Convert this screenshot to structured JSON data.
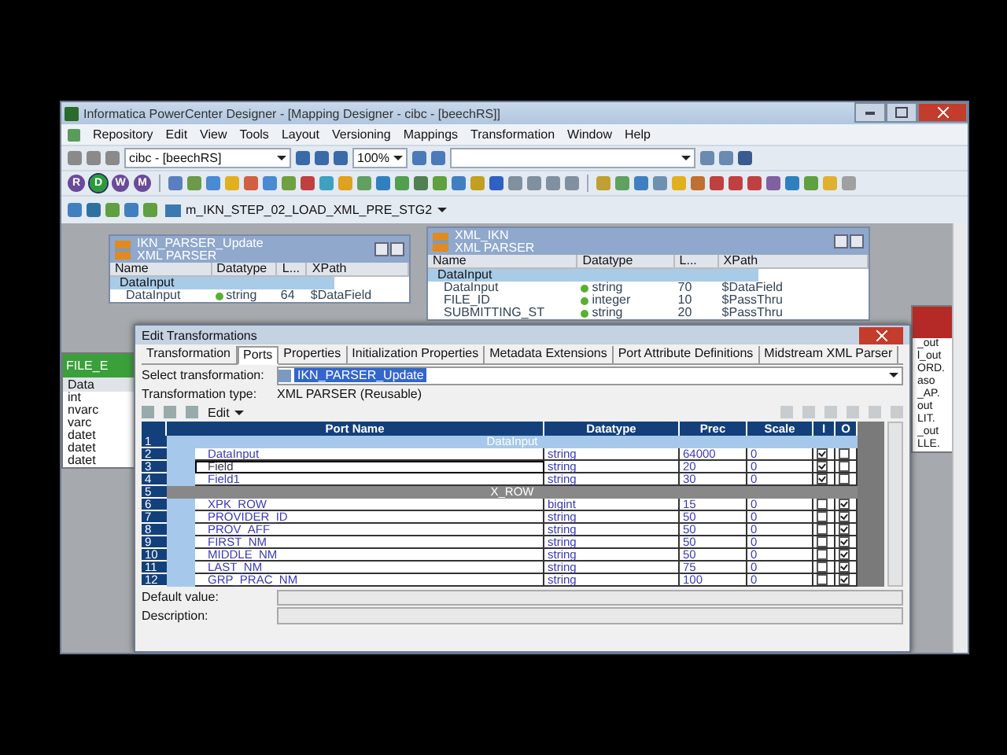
{
  "window": {
    "title": "Informatica PowerCenter Designer - [Mapping Designer - cibc - [beechRS]]"
  },
  "menu": [
    "Repository",
    "Edit",
    "View",
    "Tools",
    "Layout",
    "Versioning",
    "Mappings",
    "Transformation",
    "Window",
    "Help"
  ],
  "toolbar": {
    "repository_combo": "cibc - [beechRS]",
    "zoom_combo": "100%",
    "tool_buttons": [
      {
        "label": "R",
        "selected": false
      },
      {
        "label": "D",
        "selected": true
      },
      {
        "label": "W",
        "selected": false
      },
      {
        "label": "M",
        "selected": false
      }
    ],
    "mapping_combo": "m_IKN_STEP_02_LOAD_XML_PRE_STG2"
  },
  "canvas_objects": [
    {
      "title": "IKN_PARSER_Update",
      "subtitle": "XML PARSER",
      "columns": [
        "Name",
        "Datatype",
        "L...",
        "XPath"
      ],
      "ports": [
        {
          "kind": "group",
          "name": "DataInput"
        },
        {
          "kind": "port",
          "name": "DataInput",
          "datatype": "string",
          "length": "64",
          "xpath": "$DataField"
        }
      ]
    },
    {
      "title": "XML_IKN",
      "subtitle": "XML PARSER",
      "columns": [
        "Name",
        "Datatype",
        "L...",
        "XPath"
      ],
      "ports": [
        {
          "kind": "group",
          "name": "DataInput"
        },
        {
          "kind": "port",
          "name": "DataInput",
          "datatype": "string",
          "length": "70",
          "xpath": "$DataField"
        },
        {
          "kind": "port",
          "name": "FILE_ID",
          "datatype": "integer",
          "length": "10",
          "xpath": "$PassThru"
        },
        {
          "kind": "port",
          "name": "SUBMITTING_ST",
          "datatype": "string",
          "length": "20",
          "xpath": "$PassThru"
        }
      ]
    }
  ],
  "left_object": {
    "title": "FILE_E",
    "column": "Data",
    "rows": [
      "int",
      "nvarc",
      "varc",
      "datet",
      "datet",
      "datet"
    ]
  },
  "right_object": {
    "rows": [
      "_out",
      "l_out",
      "ORD.",
      "aso",
      "_AP.",
      "out",
      "LIT.",
      "_out",
      "LLE."
    ]
  },
  "dialog": {
    "title": "Edit Transformations",
    "tabs": [
      {
        "label": "Transformation",
        "selected": false
      },
      {
        "label": "Ports",
        "selected": true
      },
      {
        "label": "Properties",
        "selected": false
      },
      {
        "label": "Initialization Properties",
        "selected": false
      },
      {
        "label": "Metadata Extensions",
        "selected": false
      },
      {
        "label": "Port Attribute Definitions",
        "selected": false
      },
      {
        "label": "Midstream XML Parser",
        "selected": false
      }
    ],
    "select_label": "Select transformation:",
    "select_value": "IKN_PARSER_Update",
    "type_label": "Transformation type:",
    "type_value": "XML PARSER (Reusable)",
    "edit_menu": "Edit",
    "columns": [
      "Port Name",
      "Datatype",
      "Prec",
      "Scale",
      "I",
      "O"
    ],
    "rows": [
      {
        "kind": "group",
        "num": "1",
        "name": "DataInput",
        "selected": true
      },
      {
        "kind": "port",
        "num": "2",
        "name": "DataInput",
        "datatype": "string",
        "prec": "64000",
        "scale": "0",
        "input": true,
        "output": false,
        "selected": false
      },
      {
        "kind": "port",
        "num": "3",
        "name": "Field",
        "datatype": "string",
        "prec": "20",
        "scale": "0",
        "input": true,
        "output": false,
        "selected": true
      },
      {
        "kind": "port",
        "num": "4",
        "name": "Field1",
        "datatype": "string",
        "prec": "30",
        "scale": "0",
        "input": true,
        "output": false,
        "selected": false
      },
      {
        "kind": "group",
        "num": "5",
        "name": "X_ROW",
        "selected": false
      },
      {
        "kind": "port",
        "num": "6",
        "name": "XPK_ROW",
        "datatype": "bigint",
        "prec": "15",
        "scale": "0",
        "input": false,
        "output": true,
        "selected": false
      },
      {
        "kind": "port",
        "num": "7",
        "name": "PROVIDER_ID",
        "datatype": "string",
        "prec": "50",
        "scale": "0",
        "input": false,
        "output": true,
        "selected": false
      },
      {
        "kind": "port",
        "num": "8",
        "name": "PROV_AFF",
        "datatype": "string",
        "prec": "50",
        "scale": "0",
        "input": false,
        "output": true,
        "selected": false
      },
      {
        "kind": "port",
        "num": "9",
        "name": "FIRST_NM",
        "datatype": "string",
        "prec": "50",
        "scale": "0",
        "input": false,
        "output": true,
        "selected": false
      },
      {
        "kind": "port",
        "num": "10",
        "name": "MIDDLE_NM",
        "datatype": "string",
        "prec": "50",
        "scale": "0",
        "input": false,
        "output": true,
        "selected": false
      },
      {
        "kind": "port",
        "num": "11",
        "name": "LAST_NM",
        "datatype": "string",
        "prec": "75",
        "scale": "0",
        "input": false,
        "output": true,
        "selected": false
      },
      {
        "kind": "port",
        "num": "12",
        "name": "GRP_PRAC_NM",
        "datatype": "string",
        "prec": "100",
        "scale": "0",
        "input": false,
        "output": true,
        "selected": false
      }
    ],
    "default_label": "Default value:",
    "description_label": "Description:"
  }
}
